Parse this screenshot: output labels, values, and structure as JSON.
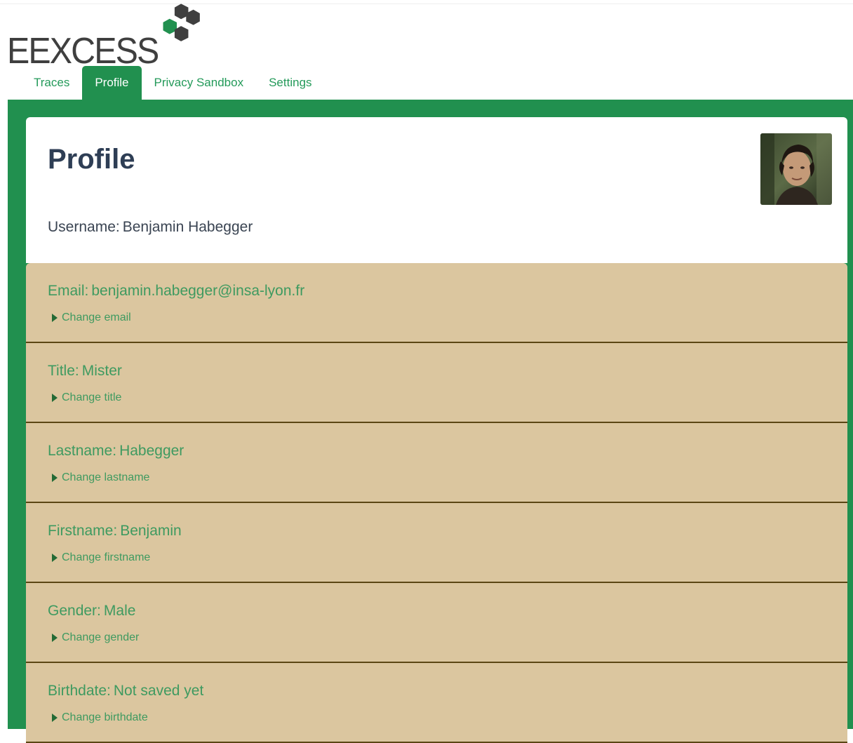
{
  "logo": {
    "text": "EEXCESS",
    "accent_color": "#21904f",
    "dark_color": "#3f3f3f"
  },
  "nav": {
    "tabs": [
      {
        "label": "Traces",
        "active": false
      },
      {
        "label": "Profile",
        "active": true
      },
      {
        "label": "Privacy Sandbox",
        "active": false
      },
      {
        "label": "Settings",
        "active": false
      }
    ]
  },
  "profile": {
    "title": "Profile",
    "username_label": "Username:",
    "username_value": "Benjamin Habegger",
    "avatar_icon": "user-photo"
  },
  "fields": [
    {
      "label": "Email:",
      "value": "benjamin.habegger@insa-lyon.fr",
      "action": "Change email"
    },
    {
      "label": "Title:",
      "value": "Mister",
      "action": "Change title"
    },
    {
      "label": "Lastname:",
      "value": "Habegger",
      "action": "Change lastname"
    },
    {
      "label": "Firstname:",
      "value": "Benjamin",
      "action": "Change firstname"
    },
    {
      "label": "Gender:",
      "value": "Male",
      "action": "Change gender"
    },
    {
      "label": "Birthdate:",
      "value": "Not saved yet",
      "action": "Change birthdate"
    }
  ],
  "colors": {
    "brand_green": "#21904f",
    "field_bg": "#dbc69f",
    "field_border": "#5b4614",
    "field_text": "#3e9a60",
    "title_text": "#2e3e55"
  }
}
